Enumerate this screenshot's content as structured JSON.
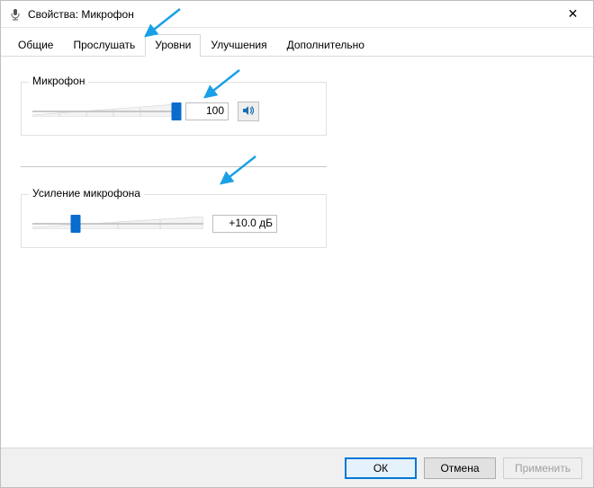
{
  "window": {
    "title": "Свойства: Микрофон"
  },
  "tabs": [
    {
      "label": "Общие"
    },
    {
      "label": "Прослушать"
    },
    {
      "label": "Уровни"
    },
    {
      "label": "Улучшения"
    },
    {
      "label": "Дополнительно"
    }
  ],
  "active_tab_index": 2,
  "levels": {
    "microphone": {
      "legend": "Микрофон",
      "value": "100",
      "slider_percent": 100
    },
    "boost": {
      "legend": "Усиление микрофона",
      "value": "+10.0 дБ",
      "slider_percent": 25
    }
  },
  "buttons": {
    "ok": "ОК",
    "cancel": "Отмена",
    "apply": "Применить"
  },
  "icons": {
    "close": "✕"
  },
  "colors": {
    "accent": "#0a6ccc",
    "arrow": "#1aa0e6"
  }
}
